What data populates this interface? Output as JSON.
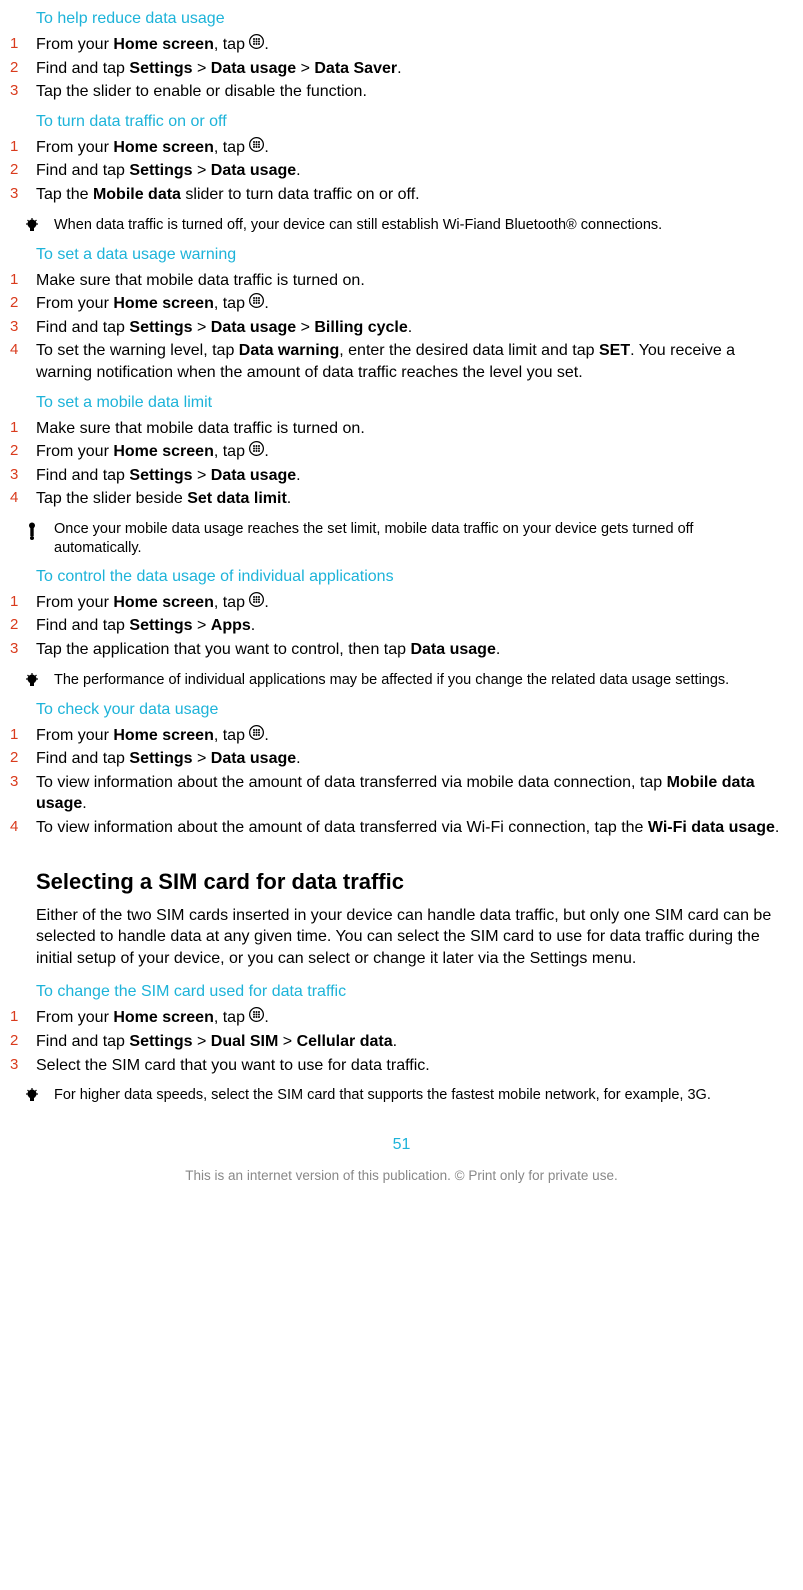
{
  "sections": {
    "reduce": {
      "title": "To help reduce data usage",
      "steps": [
        [
          {
            "t": "From your "
          },
          {
            "t": "Home screen",
            "b": true
          },
          {
            "t": ", tap "
          },
          {
            "icon": "apps"
          },
          {
            "t": "."
          }
        ],
        [
          {
            "t": "Find and tap "
          },
          {
            "t": "Settings",
            "b": true
          },
          {
            "t": " > "
          },
          {
            "t": "Data usage",
            "b": true
          },
          {
            "t": " > "
          },
          {
            "t": "Data Saver",
            "b": true
          },
          {
            "t": "."
          }
        ],
        [
          {
            "t": "Tap the slider to enable or disable the function."
          }
        ]
      ]
    },
    "traffic": {
      "title": "To turn data traffic on or off",
      "steps": [
        [
          {
            "t": "From your "
          },
          {
            "t": "Home screen",
            "b": true
          },
          {
            "t": ", tap "
          },
          {
            "icon": "apps"
          },
          {
            "t": "."
          }
        ],
        [
          {
            "t": "Find and tap "
          },
          {
            "t": "Settings",
            "b": true
          },
          {
            "t": " > "
          },
          {
            "t": "Data usage",
            "b": true
          },
          {
            "t": "."
          }
        ],
        [
          {
            "t": "Tap the "
          },
          {
            "t": "Mobile data",
            "b": true
          },
          {
            "t": " slider to turn data traffic on or off."
          }
        ]
      ],
      "note": "When data traffic is turned off, your device can still establish Wi-Fiand Bluetooth® connections."
    },
    "warning": {
      "title": "To set a data usage warning",
      "steps": [
        [
          {
            "t": "Make sure that mobile data traffic is turned on."
          }
        ],
        [
          {
            "t": "From your "
          },
          {
            "t": "Home screen",
            "b": true
          },
          {
            "t": ", tap "
          },
          {
            "icon": "apps"
          },
          {
            "t": "."
          }
        ],
        [
          {
            "t": "Find and tap "
          },
          {
            "t": "Settings",
            "b": true
          },
          {
            "t": " > "
          },
          {
            "t": "Data usage",
            "b": true
          },
          {
            "t": " > "
          },
          {
            "t": "Billing cycle",
            "b": true
          },
          {
            "t": "."
          }
        ],
        [
          {
            "t": "To set the warning level, tap "
          },
          {
            "t": "Data warning",
            "b": true
          },
          {
            "t": ", enter the desired data limit and tap "
          },
          {
            "t": "SET",
            "b": true
          },
          {
            "t": ". You receive a warning notification when the amount of data traffic reaches the level you set."
          }
        ]
      ]
    },
    "limit": {
      "title": "To set a mobile data limit",
      "steps": [
        [
          {
            "t": "Make sure that mobile data traffic is turned on."
          }
        ],
        [
          {
            "t": "From your "
          },
          {
            "t": "Home screen",
            "b": true
          },
          {
            "t": ", tap "
          },
          {
            "icon": "apps"
          },
          {
            "t": "."
          }
        ],
        [
          {
            "t": "Find and tap "
          },
          {
            "t": "Settings",
            "b": true
          },
          {
            "t": " > "
          },
          {
            "t": "Data usage",
            "b": true
          },
          {
            "t": "."
          }
        ],
        [
          {
            "t": "Tap the slider beside "
          },
          {
            "t": "Set data limit",
            "b": true
          },
          {
            "t": "."
          }
        ]
      ],
      "note": "Once your mobile data usage reaches the set limit, mobile data traffic on your device gets turned off automatically."
    },
    "individual": {
      "title": "To control the data usage of individual applications",
      "steps": [
        [
          {
            "t": "From your "
          },
          {
            "t": "Home screen",
            "b": true
          },
          {
            "t": ", tap "
          },
          {
            "icon": "apps"
          },
          {
            "t": "."
          }
        ],
        [
          {
            "t": "Find and tap "
          },
          {
            "t": "Settings",
            "b": true
          },
          {
            "t": " > "
          },
          {
            "t": "Apps",
            "b": true
          },
          {
            "t": "."
          }
        ],
        [
          {
            "t": "Tap the application that you want to control, then tap "
          },
          {
            "t": "Data usage",
            "b": true
          },
          {
            "t": "."
          }
        ]
      ],
      "note": "The performance of individual applications may be affected if you change the related data usage settings."
    },
    "check": {
      "title": "To check your data usage",
      "steps": [
        [
          {
            "t": "From your "
          },
          {
            "t": "Home screen",
            "b": true
          },
          {
            "t": ", tap "
          },
          {
            "icon": "apps"
          },
          {
            "t": "."
          }
        ],
        [
          {
            "t": "Find and tap "
          },
          {
            "t": "Settings",
            "b": true
          },
          {
            "t": " > "
          },
          {
            "t": "Data usage",
            "b": true
          },
          {
            "t": "."
          }
        ],
        [
          {
            "t": "To view information about the amount of data transferred via mobile data connection, tap "
          },
          {
            "t": "Mobile data usage",
            "b": true
          },
          {
            "t": "."
          }
        ],
        [
          {
            "t": "To view information about the amount of data transferred via Wi-Fi connection, tap the "
          },
          {
            "t": "Wi-Fi data usage",
            "b": true
          },
          {
            "t": "."
          }
        ]
      ]
    },
    "sim": {
      "section_title": "Selecting a SIM card for data traffic",
      "body": "Either of the two SIM cards inserted in your device can handle data traffic, but only one SIM card can be selected to handle data at any given time. You can select the SIM card to use for data traffic during the initial setup of your device, or you can select or change it later via the Settings menu.",
      "sub_title": "To change the SIM card used for data traffic",
      "steps": [
        [
          {
            "t": "From your "
          },
          {
            "t": "Home screen",
            "b": true
          },
          {
            "t": ", tap "
          },
          {
            "icon": "apps"
          },
          {
            "t": "."
          }
        ],
        [
          {
            "t": "Find and tap "
          },
          {
            "t": "Settings",
            "b": true
          },
          {
            "t": " > "
          },
          {
            "t": "Dual SIM",
            "b": true
          },
          {
            "t": " > "
          },
          {
            "t": "Cellular data",
            "b": true
          },
          {
            "t": "."
          }
        ],
        [
          {
            "t": "Select the SIM card that you want to use for data traffic."
          }
        ]
      ],
      "note": "For higher data speeds, select the SIM card that supports the fastest mobile network, for example, 3G."
    }
  },
  "page_number": "51",
  "footer": "This is an internet version of this publication. © Print only for private use."
}
